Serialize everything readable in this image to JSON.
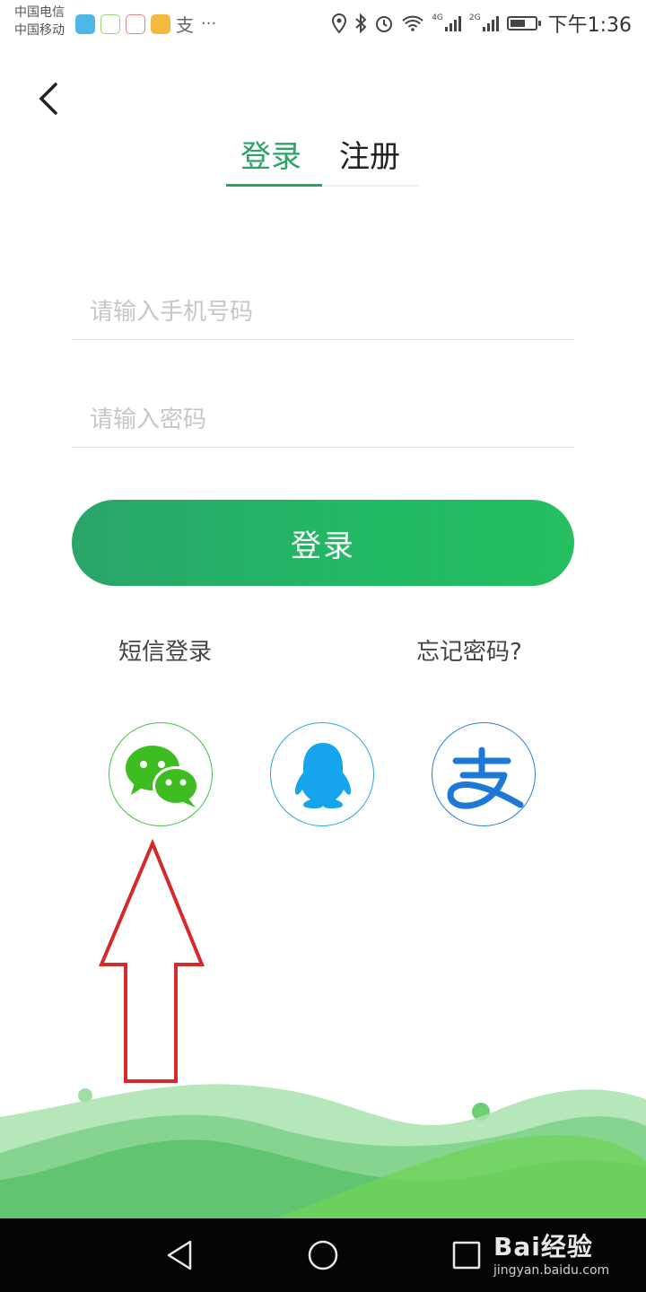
{
  "status_bar": {
    "carrier_1": "中国电信",
    "carrier_2": "中国移动",
    "notification_glyph": "支",
    "more": "···",
    "net_1": "4G",
    "net_2": "2G",
    "time": "下午1:36",
    "battery_level": 0.6,
    "icons": [
      "location-icon",
      "bluetooth-icon",
      "alarm-icon",
      "wifi-icon",
      "signal-icon",
      "battery-icon"
    ]
  },
  "header": {
    "back_icon": "chevron-left-icon"
  },
  "tabs": [
    {
      "label": "登录",
      "active": true
    },
    {
      "label": "注册",
      "active": false
    }
  ],
  "form": {
    "phone_placeholder": "请输入手机号码",
    "password_placeholder": "请输入密码",
    "login_button": "登录"
  },
  "links": {
    "sms_login": "短信登录",
    "forgot_password": "忘记密码?"
  },
  "social_logins": [
    {
      "icon": "wechat-icon",
      "color": "#3fc23f"
    },
    {
      "icon": "qq-icon",
      "color": "#16a5ec"
    },
    {
      "icon": "alipay-icon",
      "glyph": "支",
      "color": "#1e78d6"
    }
  ],
  "annotation": {
    "icon": "red-arrow-icon",
    "color": "#d42a2a"
  },
  "nav_bar": {
    "icons": [
      "nav-back-icon",
      "nav-home-icon",
      "nav-recent-icon"
    ]
  },
  "watermark": {
    "brand": "Bai经验",
    "url": "jingyan.baidu.com"
  },
  "colors": {
    "accent": "#2aa365",
    "button_start": "#2aa56a",
    "button_end": "#25bf5f"
  }
}
